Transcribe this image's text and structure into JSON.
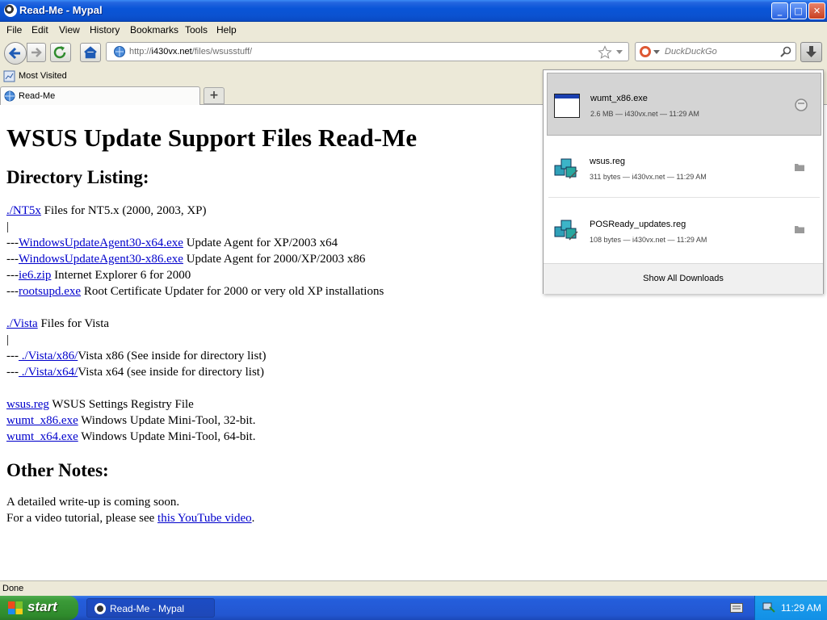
{
  "window": {
    "title": "Read-Me - Mypal",
    "buttons": {
      "minimize": "_",
      "maximize": "□",
      "close": "✕"
    }
  },
  "menu": [
    "File",
    "Edit",
    "View",
    "History",
    "Bookmarks",
    "Tools",
    "Help"
  ],
  "nav": {
    "url_prefix": "http://",
    "url_host": "i430vx.net",
    "url_path": "/files/wsusstuff/",
    "search_placeholder": "DuckDuckGo"
  },
  "bookmarks": {
    "most_visited": "Most Visited"
  },
  "tabs": [
    {
      "label": "Read-Me"
    }
  ],
  "page": {
    "title": "WSUS Update Support Files Read-Me",
    "dir_heading": "Directory Listing:",
    "nt5": {
      "link": "./NT5x",
      "desc": " Files for NT5.x (2000, 2003, XP)"
    },
    "pipe": "|",
    "nt5_items": [
      {
        "prefix": "---",
        "link": "WindowsUpdateAgent30-x64.exe",
        "desc": " Update Agent for XP/2003 x64"
      },
      {
        "prefix": "---",
        "link": "WindowsUpdateAgent30-x86.exe",
        "desc": " Update Agent for 2000/XP/2003 x86"
      },
      {
        "prefix": "---",
        "link": "ie6.zip",
        "desc": " Internet Explorer 6 for 2000"
      },
      {
        "prefix": "---",
        "link": "rootsupd.exe",
        "desc": " Root Certificate Updater for 2000 or very old XP installations"
      }
    ],
    "vista": {
      "link": "./Vista",
      "desc": " Files for Vista"
    },
    "vista_items": [
      {
        "prefix": "---",
        "link": " ./Vista/x86/",
        "desc": "Vista x86 (See inside for directory list)"
      },
      {
        "prefix": "---",
        "link": " ./Vista/x64/",
        "desc": "Vista x64 (see inside for directory list)"
      }
    ],
    "files": [
      {
        "link": "wsus.reg",
        "desc": " WSUS Settings Registry File"
      },
      {
        "link": "wumt_x86.exe",
        "desc": " Windows Update Mini-Tool, 32-bit."
      },
      {
        "link": "wumt_x64.exe",
        "desc": " Windows Update Mini-Tool, 64-bit."
      }
    ],
    "notes_heading": "Other Notes:",
    "note1": "A detailed write-up is coming soon.",
    "note2_prefix": "For a video tutorial, please see ",
    "note2_link": "this YouTube video",
    "note2_suffix": "."
  },
  "status": "Done",
  "downloads": {
    "items": [
      {
        "name": "wumt_x86.exe",
        "meta": "2.6 MB — i430vx.net — 11:29 AM",
        "icon": "exe-window-icon",
        "action_icon": "retry-circle-icon"
      },
      {
        "name": "wsus.reg",
        "meta": "311 bytes — i430vx.net — 11:29 AM",
        "icon": "registry-file-icon",
        "action_icon": "folder-icon"
      },
      {
        "name": "POSReady_updates.reg",
        "meta": "108 bytes — i430vx.net — 11:29 AM",
        "icon": "registry-file-icon",
        "action_icon": "folder-icon"
      }
    ],
    "footer": "Show All Downloads"
  },
  "taskbar": {
    "start": "start",
    "task": "Read-Me - Mypal",
    "clock": "11:29 AM"
  }
}
